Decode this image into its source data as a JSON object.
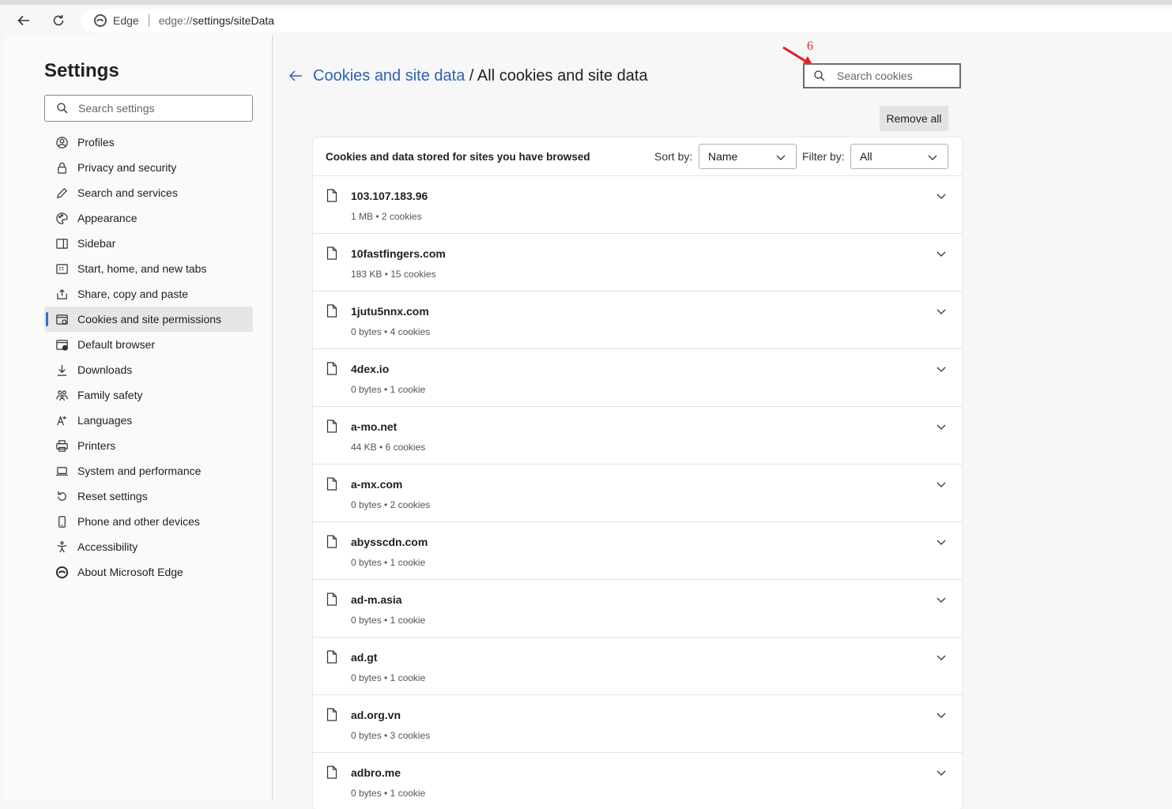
{
  "browser": {
    "brand": "Edge",
    "url_scheme": "edge://",
    "url_path": "settings/siteData"
  },
  "sidebar": {
    "title": "Settings",
    "search_placeholder": "Search settings",
    "items": [
      {
        "label": "Profiles",
        "icon": "profile-icon"
      },
      {
        "label": "Privacy and security",
        "icon": "lock-icon"
      },
      {
        "label": "Search and services",
        "icon": "pen-icon"
      },
      {
        "label": "Appearance",
        "icon": "palette-icon"
      },
      {
        "label": "Sidebar",
        "icon": "sidebar-icon"
      },
      {
        "label": "Start, home, and new tabs",
        "icon": "grid-icon"
      },
      {
        "label": "Share, copy and paste",
        "icon": "share-icon"
      },
      {
        "label": "Cookies and site permissions",
        "icon": "cookie-icon",
        "active": true
      },
      {
        "label": "Default browser",
        "icon": "browser-icon"
      },
      {
        "label": "Downloads",
        "icon": "download-icon"
      },
      {
        "label": "Family safety",
        "icon": "family-icon"
      },
      {
        "label": "Languages",
        "icon": "language-icon"
      },
      {
        "label": "Printers",
        "icon": "printer-icon"
      },
      {
        "label": "System and performance",
        "icon": "laptop-icon"
      },
      {
        "label": "Reset settings",
        "icon": "reset-icon"
      },
      {
        "label": "Phone and other devices",
        "icon": "phone-icon"
      },
      {
        "label": "Accessibility",
        "icon": "accessibility-icon"
      },
      {
        "label": "About Microsoft Edge",
        "icon": "edge-logo-icon"
      }
    ]
  },
  "main": {
    "breadcrumb_link": "Cookies and site data",
    "breadcrumb_sep": " / ",
    "breadcrumb_current": "All cookies and site data",
    "search_placeholder": "Search cookies",
    "annotation_number": "6",
    "remove_all_label": "Remove all",
    "panel_title": "Cookies and data stored for sites you have browsed",
    "sort_label": "Sort by:",
    "sort_value": "Name",
    "filter_label": "Filter by:",
    "filter_value": "All",
    "sites": [
      {
        "name": "103.107.183.96",
        "meta": "1 MB • 2 cookies"
      },
      {
        "name": "10fastfingers.com",
        "meta": "183 KB • 15 cookies"
      },
      {
        "name": "1jutu5nnx.com",
        "meta": "0 bytes • 4 cookies"
      },
      {
        "name": "4dex.io",
        "meta": "0 bytes • 1 cookie"
      },
      {
        "name": "a-mo.net",
        "meta": "44 KB • 6 cookies"
      },
      {
        "name": "a-mx.com",
        "meta": "0 bytes • 2 cookies"
      },
      {
        "name": "abysscdn.com",
        "meta": "0 bytes • 1 cookie"
      },
      {
        "name": "ad-m.asia",
        "meta": "0 bytes • 1 cookie"
      },
      {
        "name": "ad.gt",
        "meta": "0 bytes • 1 cookie"
      },
      {
        "name": "ad.org.vn",
        "meta": "0 bytes • 3 cookies"
      },
      {
        "name": "adbro.me",
        "meta": "0 bytes • 1 cookie"
      }
    ]
  },
  "colors": {
    "accent": "#2b62b5",
    "active_bar": "#2d6fcf",
    "annotation": "#e02020"
  }
}
